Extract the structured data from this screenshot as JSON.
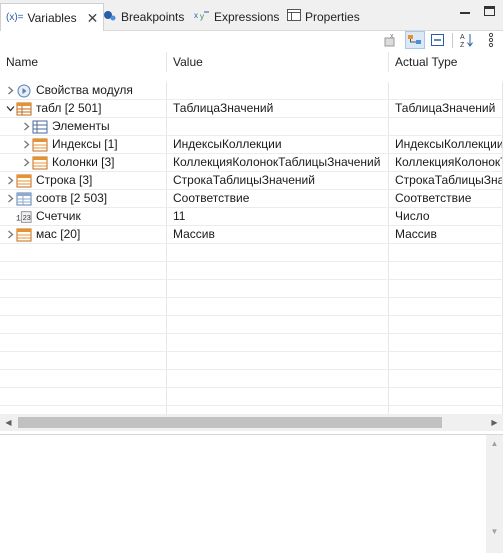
{
  "tabs": [
    {
      "label": "Variables",
      "icon": "(x)=",
      "active": true
    },
    {
      "label": "Breakpoints",
      "icon": "breakpoints-icon"
    },
    {
      "label": "Expressions",
      "icon": "expressions-icon"
    },
    {
      "label": "Properties",
      "icon": "properties-icon"
    }
  ],
  "columns": [
    "Name",
    "Value",
    "Actual Type"
  ],
  "rows": [
    {
      "name": "Свойства модуля",
      "value": "",
      "type": "",
      "indent": 0,
      "expander": "collapsed",
      "icon": "module-icon"
    },
    {
      "name": "табл [2 501]",
      "value": "ТаблицаЗначений",
      "type": "ТаблицаЗначений",
      "indent": 0,
      "expander": "expanded",
      "icon": "table-icon"
    },
    {
      "name": "Элементы",
      "value": "",
      "type": "",
      "indent": 1,
      "expander": "collapsed",
      "icon": "elements-icon"
    },
    {
      "name": "Индексы [1]",
      "value": "ИндексыКоллекции",
      "type": "ИндексыКоллекции",
      "indent": 1,
      "expander": "collapsed",
      "icon": "collection-icon"
    },
    {
      "name": "Колонки [3]",
      "value": "КоллекцияКолонокТаблицыЗначений",
      "type": "КоллекцияКолонокТ",
      "indent": 1,
      "expander": "collapsed",
      "icon": "collection-icon"
    },
    {
      "name": "Строка [3]",
      "value": "СтрокаТаблицыЗначений",
      "type": "СтрокаТаблицыЗна",
      "indent": 0,
      "expander": "collapsed",
      "icon": "collection-icon"
    },
    {
      "name": "соотв [2 503]",
      "value": "Соответствие",
      "type": "Соответствие",
      "indent": 0,
      "expander": "collapsed",
      "icon": "map-icon"
    },
    {
      "name": "Счетчик",
      "value": "11",
      "type": "Число",
      "indent": 0,
      "expander": "none",
      "icon": "number-icon"
    },
    {
      "name": "мас [20]",
      "value": "Массив",
      "type": "Массив",
      "indent": 0,
      "expander": "collapsed",
      "icon": "collection-icon"
    }
  ],
  "empty_rows": 10,
  "colors": {
    "accent": "#2a5ea8",
    "pressed": "#dbe9f7",
    "orange_icon": "#e8912f"
  }
}
